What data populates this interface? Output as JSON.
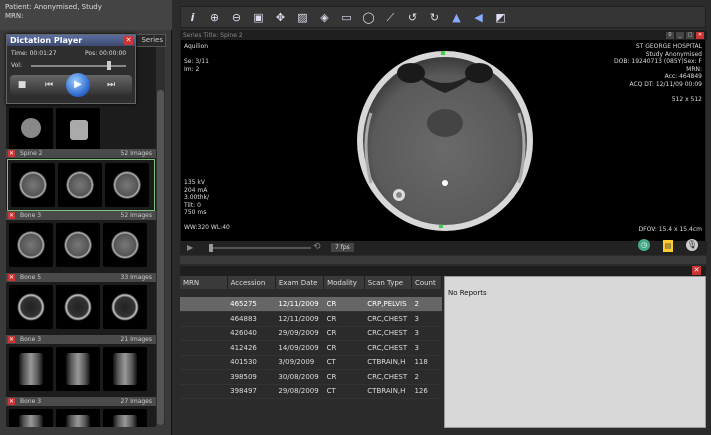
{
  "patient": {
    "line1": "Patient: Anonymised, Study",
    "line2": "MRN:"
  },
  "series_tab": "Series",
  "dictation": {
    "title": "Dictation Player",
    "time": "Time: 00:01:27",
    "pos": "Pos: 00:00:00",
    "vol_label": "Vol:",
    "volume_fraction": 0.82
  },
  "series": [
    {
      "name": "",
      "count": ""
    },
    {
      "name": "Spine 2",
      "count": "52 Images"
    },
    {
      "name": "Bone 3",
      "count": "52 Images"
    },
    {
      "name": "Bone 5",
      "count": "33 Images"
    },
    {
      "name": "Bone 3",
      "count": "21 Images"
    },
    {
      "name": "Bone 3",
      "count": "27 Images"
    }
  ],
  "toolbar_icons": [
    "info-icon",
    "zoom-in-icon",
    "zoom-out-icon",
    "window-level-icon",
    "pan-icon",
    "image-icon",
    "tag-icon",
    "rect-roi-icon",
    "ellipse-roi-icon",
    "ruler-icon",
    "rotate-left-icon",
    "rotate-right-icon",
    "flip-vertical-icon",
    "flip-horizontal-icon",
    "invert-icon"
  ],
  "viewer": {
    "series_title": "Series Title: Spine 2",
    "frame_index": "0",
    "top_left": [
      "Aquilion",
      "",
      "Se: 3/11",
      "Im: 2"
    ],
    "top_right": [
      "ST GEORGE HOSPITAL",
      "Study Anonymised",
      "DOB: 19240713 (085Y)Sex: F",
      "MRN:",
      "Acc: 464849",
      "ACQ DT: 12/11/09 00:09",
      "",
      "512 x 512"
    ],
    "bottom_left": [
      "135 kV",
      "204 mA",
      "3.00thk/",
      "Tilt: 0",
      "750 ms",
      "",
      "WW:320 WL:40"
    ],
    "bottom_right": "DFOV: 15.4 x 15.4cm",
    "fps": "7 fps"
  },
  "table": {
    "headers": [
      "MRN",
      "Accession",
      "Exam Date",
      "Modality",
      "Scan Type",
      "Count"
    ],
    "rows": [
      [
        "",
        "465275",
        "12/11/2009",
        "CR",
        "CRP,PELVIS",
        "2"
      ],
      [
        "",
        "464883",
        "12/11/2009",
        "CR",
        "CRC,CHEST",
        "3"
      ],
      [
        "",
        "426040",
        "29/09/2009",
        "CR",
        "CRC,CHEST",
        "3"
      ],
      [
        "",
        "412426",
        "14/09/2009",
        "CR",
        "CRC,CHEST",
        "3"
      ],
      [
        "",
        "401530",
        "3/09/2009",
        "CT",
        "CTBRAIN,H",
        "118"
      ],
      [
        "",
        "398509",
        "30/08/2009",
        "CR",
        "CRC,CHEST",
        "2"
      ],
      [
        "",
        "398497",
        "29/08/2009",
        "CT",
        "CTBRAIN,H",
        "126"
      ]
    ]
  },
  "reports": {
    "text": "No Reports"
  },
  "colors": {
    "selected_row": "#666666",
    "close_red": "#cc3333",
    "active_series": "#7fc27f"
  }
}
